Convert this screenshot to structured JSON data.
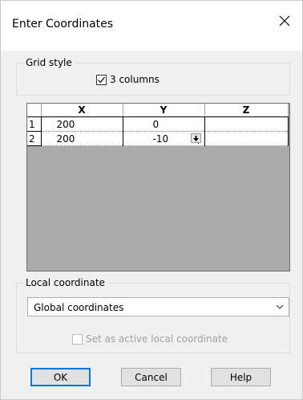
{
  "window": {
    "title": "Enter Coordinates"
  },
  "grid_style": {
    "legend": "Grid style",
    "checkbox_label": "3 columns",
    "checked": true
  },
  "grid": {
    "columns": [
      "X",
      "Y",
      "Z"
    ],
    "rows": [
      {
        "index": "1",
        "x": "200",
        "y": "0",
        "z": ""
      },
      {
        "index": "2",
        "x": "200",
        "y": "-10",
        "z": ""
      }
    ]
  },
  "local_coordinate": {
    "legend": "Local coordinate",
    "selected": "Global coordinates",
    "active_label": "Set as active local coordinate",
    "active_checked": false
  },
  "buttons": {
    "ok": "OK",
    "cancel": "Cancel",
    "help": "Help"
  },
  "colors": {
    "accent": "#0078d7",
    "dialog_bg": "#f0f0f0",
    "grid_empty": "#ababab"
  }
}
